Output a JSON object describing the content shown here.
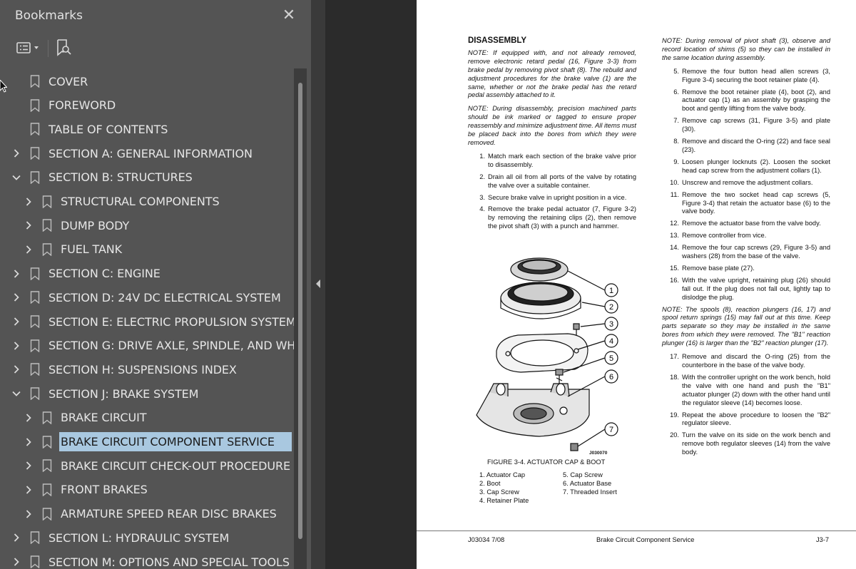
{
  "bookmarks_panel": {
    "title": "Bookmarks",
    "close_glyph": "✕",
    "options_icon": "list-options-icon",
    "bookmark_search_icon": "bookmark-search-icon",
    "items": [
      {
        "label": "COVER",
        "level": 0,
        "expand": "none"
      },
      {
        "label": "FOREWORD",
        "level": 0,
        "expand": "none"
      },
      {
        "label": "TABLE OF CONTENTS",
        "level": 0,
        "expand": "none"
      },
      {
        "label": "SECTION A: GENERAL INFORMATION",
        "level": 0,
        "expand": "collapsed"
      },
      {
        "label": "SECTION B: STRUCTURES",
        "level": 0,
        "expand": "expanded"
      },
      {
        "label": "STRUCTURAL COMPONENTS",
        "level": 1,
        "expand": "collapsed"
      },
      {
        "label": "DUMP BODY",
        "level": 1,
        "expand": "collapsed"
      },
      {
        "label": "FUEL TANK",
        "level": 1,
        "expand": "collapsed"
      },
      {
        "label": "SECTION C: ENGINE",
        "level": 0,
        "expand": "collapsed"
      },
      {
        "label": "SECTION D: 24V DC ELECTRICAL SYSTEM",
        "level": 0,
        "expand": "collapsed"
      },
      {
        "label": "SECTION E: ELECTRIC PROPULSION SYSTEM",
        "level": 0,
        "expand": "collapsed"
      },
      {
        "label": "SECTION G: DRIVE AXLE, SPINDLE, AND WHEELS",
        "level": 0,
        "expand": "collapsed"
      },
      {
        "label": "SECTION H:  SUSPENSIONS INDEX",
        "level": 0,
        "expand": "collapsed"
      },
      {
        "label": "SECTION J: BRAKE SYSTEM",
        "level": 0,
        "expand": "expanded"
      },
      {
        "label": "BRAKE CIRCUIT",
        "level": 1,
        "expand": "collapsed"
      },
      {
        "label": "BRAKE CIRCUIT COMPONENT SERVICE",
        "level": 1,
        "expand": "collapsed",
        "selected": true
      },
      {
        "label": "BRAKE CIRCUIT CHECK-OUT PROCEDURE",
        "level": 1,
        "expand": "collapsed"
      },
      {
        "label": "FRONT BRAKES",
        "level": 1,
        "expand": "collapsed"
      },
      {
        "label": "ARMATURE SPEED REAR DISC BRAKES",
        "level": 1,
        "expand": "collapsed"
      },
      {
        "label": "SECTION L:  HYDRAULIC SYSTEM",
        "level": 0,
        "expand": "collapsed"
      },
      {
        "label": "SECTION M: OPTIONS AND SPECIAL TOOLS",
        "level": 0,
        "expand": "collapsed"
      }
    ]
  },
  "document": {
    "heading": "DISASSEMBLY",
    "note1": "NOTE: If equipped with, and not already removed, remove electronic retard pedal (16, Figure 3-3) from brake pedal by removing pivot shaft (8). The rebuild and adjustment procedures for the brake valve (1) are the same, whether or not the brake pedal has the retard pedal assembly attached to it.",
    "note2": "NOTE: During disassembly, precision machined parts should be ink marked or tagged to ensure proper reassembly and minimize adjustment time. All items must be placed back into the bores from which they were removed.",
    "steps_left": [
      {
        "n": "1.",
        "t": "Match mark each section of the brake valve prior to disassembly."
      },
      {
        "n": "2.",
        "t": "Drain all oil from all ports of the valve by rotating the valve over a suitable container."
      },
      {
        "n": "3.",
        "t": "Secure brake valve in upright position in a vice."
      },
      {
        "n": "4.",
        "t": "Remove the brake pedal actuator (7, Figure 3-2) by removing the retaining clips (2), then remove the pivot shaft (3) with a punch and hammer."
      }
    ],
    "note3": "NOTE: During removal of pivot shaft (3), observe and record location of shims (5) so they can be installed in the same location during assembly.",
    "steps_right_a": [
      {
        "n": "5.",
        "t": "Remove the four button head allen screws (3, Figure 3-4) securing the boot retainer plate (4)."
      },
      {
        "n": "6.",
        "t": "Remove the boot retainer plate (4), boot (2), and actuator cap (1) as an assembly by grasping the boot and gently lifting from the valve body."
      },
      {
        "n": "7.",
        "t": "Remove cap screws (31, Figure 3-5) and plate (30)."
      },
      {
        "n": "8.",
        "t": "Remove and discard the O-ring (22) and face seal (23)."
      },
      {
        "n": "9.",
        "t": "Loosen plunger locknuts (2). Loosen the socket head cap screw from the adjustment collars (1)."
      },
      {
        "n": "10.",
        "t": "Unscrew and remove the adjustment collars."
      },
      {
        "n": "11.",
        "t": "Remove the two socket head cap screws (5, Figure 3-4) that retain the actuator base (6) to the valve body."
      },
      {
        "n": "12.",
        "t": "Remove the actuator base from the valve body."
      },
      {
        "n": "13.",
        "t": "Remove controller from vice."
      },
      {
        "n": "14.",
        "t": "Remove the four cap screws (29, Figure 3-5) and washers (28) from the base of the valve."
      },
      {
        "n": "15.",
        "t": "Remove base plate (27)."
      },
      {
        "n": "16.",
        "t": "With the valve upright, retaining plug (26) should fall out. If the plug does not fall out, lightly tap to dislodge the plug."
      }
    ],
    "note4": "NOTE: The spools (8), reaction plungers (16, 17) and spool return springs (15) may fall out at this time. Keep parts separate so they may be installed in the same bores from which they were removed. The \"B1\" reaction plunger (16) is larger than the \"B2\" reaction plunger (17).",
    "steps_right_b": [
      {
        "n": "17.",
        "t": "Remove and discard the O-ring (25) from the counterbore in the base of the valve body."
      },
      {
        "n": "18.",
        "t": "With the controller upright on the work bench, hold the valve with one hand and push the \"B1\" actuator plunger (2) down with the other hand until the regulator sleeve (14) becomes loose."
      },
      {
        "n": "19.",
        "t": "Repeat the above procedure to loosen the \"B2\" regulator sleeve."
      },
      {
        "n": "20.",
        "t": "Turn the valve on its side on the work bench and remove both regulator sleeves (14) from the valve body."
      }
    ],
    "figure": {
      "caption": "FIGURE 3-4. ACTUATOR CAP & BOOT",
      "image_id": "J030070",
      "callouts": [
        "1",
        "2",
        "3",
        "4",
        "5",
        "6",
        "7"
      ],
      "legend": [
        "1. Actuator Cap",
        "2. Boot",
        "3. Cap Screw",
        "4. Retainer Plate",
        "5. Cap Screw",
        "6. Actuator Base",
        "7. Threaded Insert"
      ]
    },
    "footer": {
      "left": "J03034  7/08",
      "center": "Brake Circuit Component Service",
      "right": "J3-7"
    }
  }
}
